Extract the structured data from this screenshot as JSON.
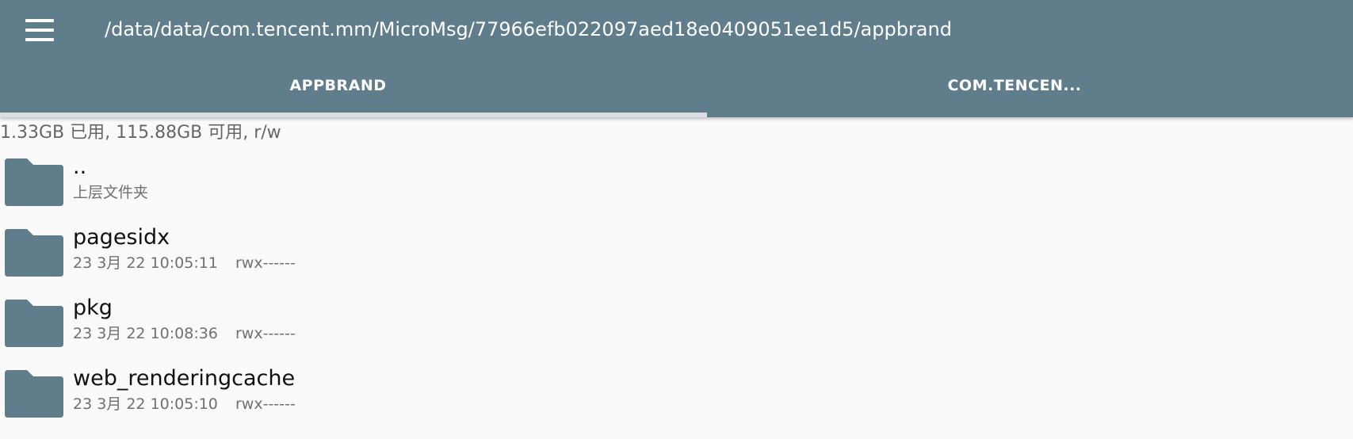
{
  "toolbar": {
    "menu_icon": "hamburger-menu-icon",
    "path": "/data/data/com.tencent.mm/MicroMsg/77966efb022097aed18e0409051ee1d5/appbrand"
  },
  "tabs": [
    {
      "label": "APPBRAND",
      "selected": true
    },
    {
      "label": "COM.TENCEN...",
      "selected": false
    }
  ],
  "storage_info": "1.33GB 已用, 115.88GB 可用, r/w",
  "colors": {
    "toolbar_bg": "#607d8b",
    "folder_icon": "#607d8b",
    "background": "#fafafa"
  },
  "items": [
    {
      "name": "..",
      "subtitle": "上层文件夹",
      "permissions": "",
      "icon": "folder-icon"
    },
    {
      "name": "pagesidx",
      "subtitle": "23 3月 22 10:05:11",
      "permissions": "rwx------",
      "icon": "folder-icon"
    },
    {
      "name": "pkg",
      "subtitle": "23 3月 22 10:08:36",
      "permissions": "rwx------",
      "icon": "folder-icon"
    },
    {
      "name": "web_renderingcache",
      "subtitle": "23 3月 22 10:05:10",
      "permissions": "rwx------",
      "icon": "folder-icon"
    }
  ]
}
